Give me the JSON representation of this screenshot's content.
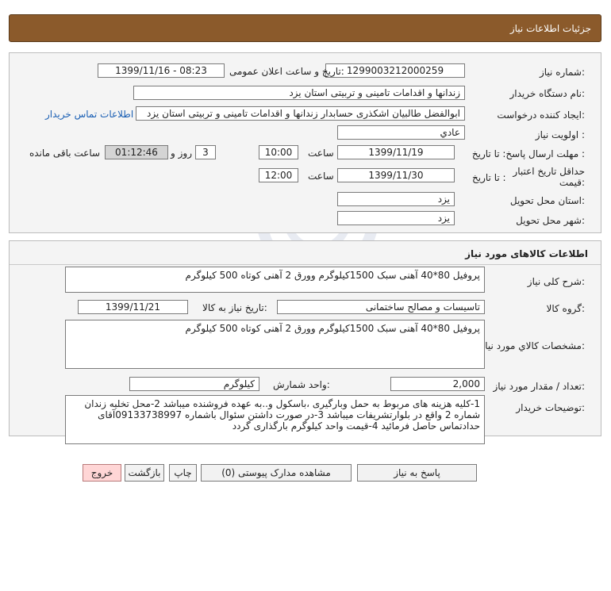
{
  "header": {
    "title": "جزئیات اطلاعات نیاز"
  },
  "info": {
    "need_number_label": "شماره نیاز:",
    "need_number": "1299003212000259",
    "announce_label": "تاریخ و ساعت اعلان عمومی:",
    "announce_value": "1399/11/16 - 08:23",
    "buyer_org_label": "نام دستگاه خریدار:",
    "buyer_org": "زندانها و اقدامات تامینی و تربیتی استان یزد",
    "creator_label": "ایجاد کننده درخواست:",
    "creator": "ابوالفضل  طالبیان اشکذری حسابدار زندانها و اقدامات تامینی و تربیتی استان یزد",
    "contact_link": "اطلاعات تماس خریدار",
    "priority_label": "اولویت نیاز :",
    "priority": "عادي",
    "deadline_label": "مهلت ارسال پاسخ: تا تاریخ :",
    "deadline_date": "1399/11/19",
    "time_label": "ساعت",
    "deadline_time": "10:00",
    "days_value": "3",
    "days_label": "روز و",
    "remaining_time": "01:12:46",
    "remaining_label": "ساعت باقی مانده",
    "validity_label_1": "حداقل تاریخ اعتبار",
    "validity_label_2": "قیمت:",
    "validity_to_label": "تا تاریخ :",
    "validity_date": "1399/11/30",
    "validity_time_label": "ساعت",
    "validity_time": "12:00",
    "province_label": "استان محل تحویل:",
    "province": "یزد",
    "city_label": "شهر محل تحویل:",
    "city": "یزد"
  },
  "goods": {
    "section_title": "اطلاعات کالاهای مورد نیاز",
    "general_desc_label": "شرح کلی نیاز:",
    "general_desc": "پروفیل 80*40 آهنی سبک 1500کیلوگرم وورق 2 آهنی کوتاه 500 کیلوگرم",
    "group_label": "گروه کالا:",
    "group": "تاسیسات و مصالح ساختمانی",
    "need_date_label": "تاریخ نیاز به کالا:",
    "need_date": "1399/11/21",
    "specs_label": "مشخصات کالاي مورد نیاز:",
    "specs": "پروفیل 80*40 آهنی سبک 1500کیلوگرم وورق 2 آهنی کوتاه 500 کیلوگرم",
    "qty_label": "تعداد / مقدار مورد نیاز:",
    "qty": "2,000",
    "unit_label": "واحد شمارش:",
    "unit": "کیلوگرم",
    "buyer_notes_label": "توضیحات خریدار:",
    "buyer_notes": "1-کلیه هزینه های مربوط به حمل وبارگیری ،باسکول و..به عهده فروشنده میباشد 2-محل تخلیه زندان شماره 2 واقع در بلوارتشریفات میباشد 3-در صورت داشتن سئوال باشماره 09133738997آقای حدادتماس حاصل فرمائید 4-قیمت واحد کیلوگرم بارگذاری گردد"
  },
  "actions": {
    "reply_label": "پاسخ به نیاز",
    "attachments_label": "مشاهده مدارک پیوستی (0)",
    "print_label": "چاپ",
    "back_label": "بازگشت",
    "exit_label": "خروج"
  },
  "colors": {
    "header_bg": "#8b5a2b",
    "panel_bg": "#f4f4f4",
    "link": "#1a5fb4",
    "exit_bg": "#ffd6d6"
  }
}
